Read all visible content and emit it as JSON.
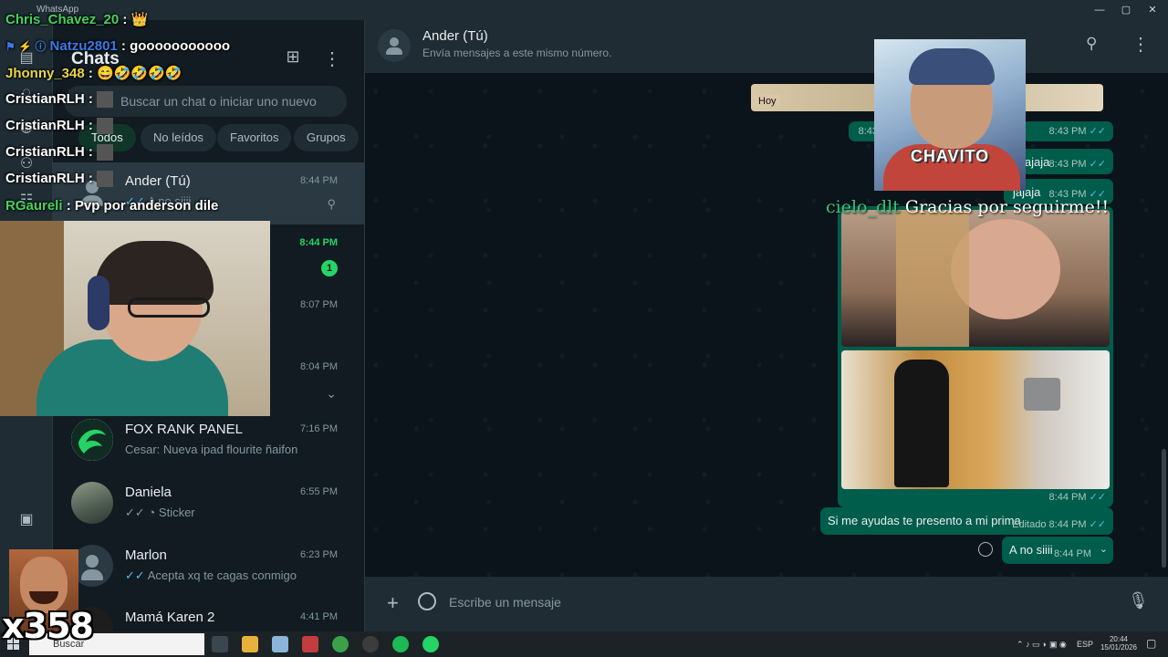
{
  "window": {
    "title": "WhatsApp",
    "controls": [
      "—",
      "▢",
      "✕"
    ]
  },
  "sidebar": {
    "title": "Chats",
    "search_placeholder": "Buscar un chat o iniciar uno nuevo",
    "filters": [
      {
        "label": "Todos",
        "active": true
      },
      {
        "label": "No leídos",
        "active": false
      },
      {
        "label": "Favoritos",
        "active": false
      },
      {
        "label": "Grupos",
        "active": false
      }
    ],
    "chats": [
      {
        "name": "Ander (Tú)",
        "time": "8:44 PM",
        "preview": "A no siiii",
        "pinned": true,
        "selected": true
      },
      {
        "name": "",
        "time": "8:44 PM",
        "preview": "",
        "unread": "1"
      },
      {
        "name": "",
        "time": "8:07 PM",
        "preview": ""
      },
      {
        "name": "",
        "time": "8:04 PM",
        "preview": ""
      },
      {
        "name": "FOX RANK PANEL",
        "time": "7:16 PM",
        "preview": "Cesar: Nueva ipad flourite ñaifon"
      },
      {
        "name": "Daniela",
        "time": "6:55 PM",
        "preview": "Sticker"
      },
      {
        "name": "Marlon",
        "time": "6:23 PM",
        "preview": "Acepta xq te cagas conmigo"
      },
      {
        "name": "Mamá Karen 2",
        "time": "4:41 PM",
        "preview": ""
      }
    ]
  },
  "conversation": {
    "contact": "Ander (Tú)",
    "subtitle": "Envía mensajes a este mismo número.",
    "messages": {
      "hoy_label": "Hoy",
      "t1": "8:43",
      "t2": "8:43 PM",
      "m3_text": "jajaja",
      "m3_time": "8:43 PM",
      "m4_text": "jajaja",
      "m4_time": "8:43 PM",
      "img_time": "8:44 PM",
      "m5_text": "Si me ayudas te presento a mi prima",
      "m5_edited": "Editado",
      "m5_time": "8:44 PM",
      "m6_text": "A no siiii",
      "m6_time": "8:44 PM"
    },
    "composer_placeholder": "Escribe un mensaje"
  },
  "taskbar": {
    "search_placeholder": "Buscar",
    "lang": "ESP",
    "time": "20:44",
    "date": "15/01/2026"
  },
  "overlay": {
    "chat_lines": [
      {
        "user": "Chris_Chavez_20",
        "message": "👑",
        "color": "#46d15c"
      },
      {
        "user": "Natzu2801",
        "message": "gooooooooooo",
        "color": "#3a79e6"
      },
      {
        "user": "Jhonny_348",
        "message": "😄🤣🤣🤣🤣",
        "color": "#e8d64a"
      },
      {
        "user": "CristianRLH",
        "message": "",
        "color": "#ffffff"
      },
      {
        "user": "CristianRLH",
        "message": "",
        "color": "#ffffff"
      },
      {
        "user": "CristianRLH",
        "message": "",
        "color": "#ffffff"
      },
      {
        "user": "CristianRLH",
        "message": "",
        "color": "#ffffff"
      },
      {
        "user": "RGaureli",
        "message": "Pvp por anderson dile",
        "color": "#46d15c"
      }
    ],
    "alert_caption": "CHAVITO",
    "follower_name": "cielo_dlt",
    "follower_message": "Gracias por seguirme!!",
    "counter": "x358"
  }
}
